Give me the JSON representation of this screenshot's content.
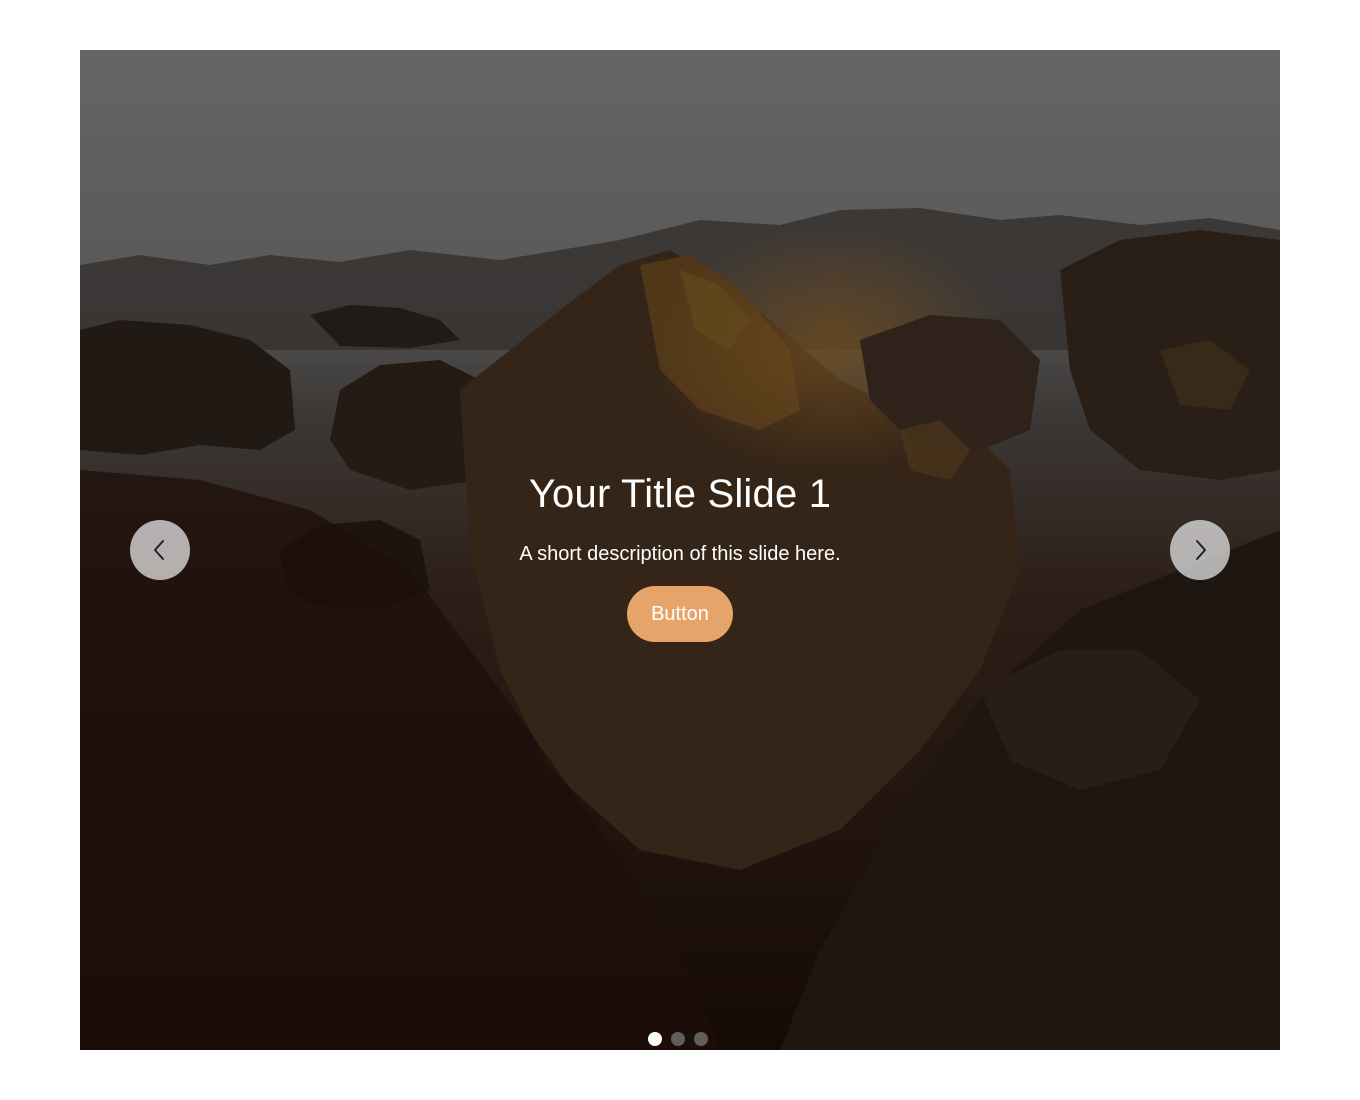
{
  "slide": {
    "title": "Your Title Slide 1",
    "description": "A short description of this slide here.",
    "button_label": "Button"
  },
  "navigation": {
    "prev_icon": "chevron-left-icon",
    "next_icon": "chevron-right-icon"
  },
  "pagination": {
    "total": 3,
    "active_index": 1
  },
  "colors": {
    "button": "#E6A46B",
    "dot_active": "#FFFFFF",
    "dot_inactive": "#787878",
    "nav_bg": "#DCDCDC"
  }
}
